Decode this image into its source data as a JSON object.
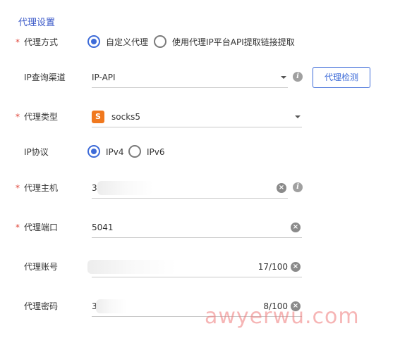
{
  "section": {
    "title": "代理设置"
  },
  "proxy_mode": {
    "required_mark": "*",
    "label": "代理方式",
    "options": [
      {
        "label": "自定义代理",
        "checked": true
      },
      {
        "label": "使用代理IP平台API提取链接提取",
        "checked": false
      }
    ]
  },
  "ip_query": {
    "label": "IP查询渠道",
    "value": "IP-API",
    "detect_button": "代理检测"
  },
  "proxy_type": {
    "required_mark": "*",
    "label": "代理类型",
    "badge": "S",
    "badge_color": "#f0781e",
    "value": "socks5"
  },
  "ip_protocol": {
    "label": "IP协议",
    "options": [
      {
        "label": "IPv4",
        "checked": true
      },
      {
        "label": "IPv6",
        "checked": false
      }
    ]
  },
  "proxy_host": {
    "required_mark": "*",
    "label": "代理主机",
    "value": "3"
  },
  "proxy_port": {
    "required_mark": "*",
    "label": "代理端口",
    "value": "5041"
  },
  "proxy_account": {
    "label": "代理账号",
    "counter": "17/100"
  },
  "proxy_password": {
    "label": "代理密码",
    "value": "3",
    "counter": "8/100"
  },
  "icons": {
    "clear": "×",
    "info": "i"
  },
  "watermark": "awyerwu.com",
  "colors": {
    "accent": "#3d6bd8",
    "title": "#3d5bc9",
    "required": "#e0463a"
  }
}
